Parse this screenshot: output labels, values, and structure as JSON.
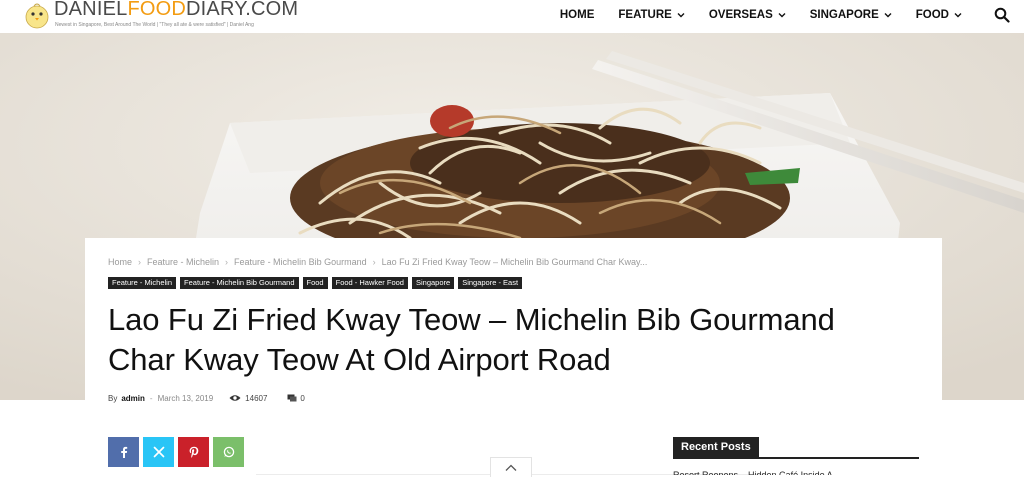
{
  "header": {
    "logo": {
      "title_part1": "DANIEL",
      "title_part2": "FOOD",
      "title_part3": "DIARY.COM",
      "tagline": "Newest in Singapore, Best Around The World | \"They all ate & were satisfied\" | Daniel Ang"
    },
    "nav": [
      {
        "label": "HOME",
        "has_dropdown": false
      },
      {
        "label": "FEATURE",
        "has_dropdown": true
      },
      {
        "label": "OVERSEAS",
        "has_dropdown": true
      },
      {
        "label": "SINGAPORE",
        "has_dropdown": true
      },
      {
        "label": "FOOD",
        "has_dropdown": true
      }
    ],
    "search_icon": "search-icon"
  },
  "article": {
    "breadcrumb": [
      "Home",
      "Feature - Michelin",
      "Feature - Michelin Bib Gourmand",
      "Lao Fu Zi Fried Kway Teow – Michelin Bib Gourmand Char Kway..."
    ],
    "tags": [
      "Feature - Michelin",
      "Feature - Michelin Bib Gourmand",
      "Food",
      "Food - Hawker Food",
      "Singapore",
      "Singapore - East"
    ],
    "title_line1": "Lao Fu Zi Fried Kway Teow – Michelin Bib Gourmand",
    "title_line2": "Char Kway Teow At Old Airport Road",
    "meta": {
      "by": "By",
      "author": "admin",
      "dash": "-",
      "date": "March 13, 2019",
      "views": "14607",
      "comments": "0"
    }
  },
  "share": [
    {
      "network": "facebook",
      "icon": "facebook-icon",
      "color": "#516eab"
    },
    {
      "network": "x",
      "icon": "x-icon",
      "color": "#29c5f6"
    },
    {
      "network": "pinterest",
      "icon": "pinterest-icon",
      "color": "#ca212a"
    },
    {
      "network": "whatsapp",
      "icon": "whatsapp-icon",
      "color": "#7bbf6a"
    }
  ],
  "sidebar": {
    "recent_title": "Recent Posts",
    "first_item": "Resort Reopens – Hidden Café Inside A"
  },
  "colors": {
    "logo_orange": "#f39c12",
    "tag_bg": "#222222",
    "text_dark": "#111111"
  }
}
